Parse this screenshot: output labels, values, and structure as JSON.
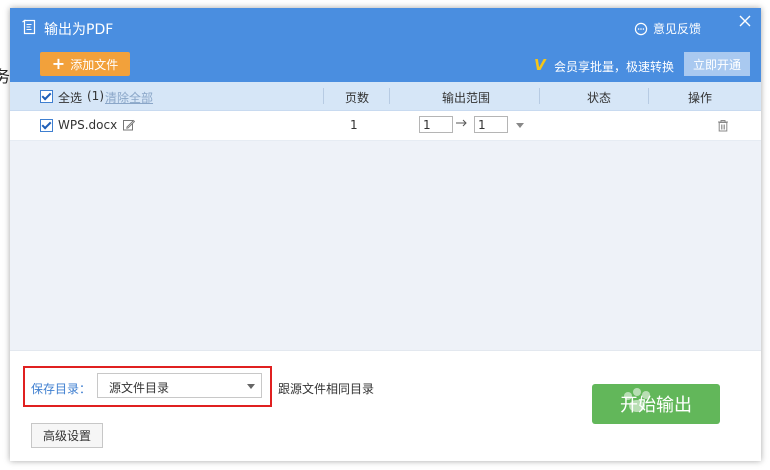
{
  "background": {
    "partial_text": "务"
  },
  "dialog": {
    "title": "输出为PDF",
    "feedback_label": "意见反馈",
    "close_icon": "close-icon",
    "accent_color": "#4a8ee0"
  },
  "toolbar": {
    "add_file_label": "添加文件",
    "vip_icon": "V",
    "vip_text": "会员享批量，极速转换",
    "open_now_label": "立即开通"
  },
  "table": {
    "select_all_label": "全选",
    "select_count": "(1)",
    "clear_all_label": "清除全部",
    "columns": {
      "pages": "页数",
      "range": "输出范围",
      "status": "状态",
      "action": "操作"
    },
    "rows": [
      {
        "checked": true,
        "file_name": "WPS.docx",
        "pages": "1",
        "range_from": "1",
        "range_to": "1",
        "status": ""
      }
    ]
  },
  "bottom": {
    "save_dir_label": "保存目录：",
    "save_dir_value": "源文件目录",
    "save_dir_hint": "跟源文件相同目录",
    "start_label": "开始输出",
    "advanced_label": "高级设置"
  }
}
